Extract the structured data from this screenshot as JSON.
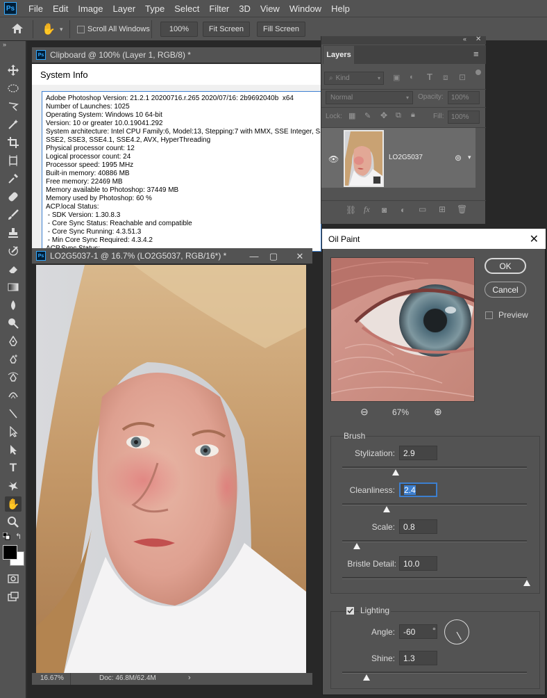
{
  "app": {
    "logo": "Ps"
  },
  "menu": [
    "File",
    "Edit",
    "Image",
    "Layer",
    "Type",
    "Select",
    "Filter",
    "3D",
    "View",
    "Window",
    "Help"
  ],
  "options_bar": {
    "scroll_all_label": "Scroll All Windows",
    "zoom_100": "100%",
    "fit_screen": "Fit Screen",
    "fill_screen": "Fill Screen"
  },
  "clipboard_window": {
    "title": "Clipboard @ 100% (Layer 1, RGB/8) *",
    "sysinfo_title": "System Info",
    "lines": [
      "Adobe Photoshop Version: 21.2.1 20200716.r.265 2020/07/16: 2b9692040b  x64",
      "Number of Launches: 1025",
      "Operating System: Windows 10 64-bit",
      "Version: 10 or greater 10.0.19041.292",
      "System architecture: Intel CPU Family:6, Model:13, Stepping:7 with MMX, SSE Integer, SSE FP,",
      "SSE2, SSE3, SSE4.1, SSE4.2, AVX, HyperThreading",
      "Physical processor count: 12",
      "Logical processor count: 24",
      "Processor speed: 1995 MHz",
      "Built-in memory: 40886 MB",
      "Free memory: 22469 MB",
      "Memory available to Photoshop: 37449 MB",
      "Memory used by Photoshop: 60 %",
      "ACP.local Status:",
      " - SDK Version: 1.30.8.3",
      " - Core Sync Status: Reachable and compatible",
      " - Core Sync Running: 4.3.51.3",
      " - Min Core Sync Required: 4.3.4.2",
      "ACP.Sync Status:"
    ]
  },
  "doc_window": {
    "title": "LO2G5037-1 @ 16.7% (LO2G5037, RGB/16*) *",
    "zoom": "16.67%",
    "doc_info": "Doc: 46.8M/62.4M"
  },
  "layers_panel": {
    "tab": "Layers",
    "kind_label": "Kind",
    "blend_mode": "Normal",
    "opacity_label": "Opacity:",
    "opacity_value": "100%",
    "lock_label": "Lock:",
    "fill_label": "Fill:",
    "fill_value": "100%",
    "layer_name": "LO2G5037"
  },
  "oil_paint": {
    "title": "Oil Paint",
    "ok": "OK",
    "cancel": "Cancel",
    "preview_label": "Preview",
    "preview_checked": false,
    "zoom": "67%",
    "brush_group": "Brush",
    "stylization_label": "Stylization:",
    "stylization": "2.9",
    "stylization_pos": 0.29,
    "cleanliness_label": "Cleanliness:",
    "cleanliness": "2.4",
    "cleanliness_pos": 0.24,
    "scale_label": "Scale:",
    "scale": "0.8",
    "scale_pos": 0.08,
    "bristle_label": "Bristle Detail:",
    "bristle": "10.0",
    "bristle_pos": 1.0,
    "lighting_label": "Lighting",
    "lighting_checked": true,
    "angle_label": "Angle:",
    "angle": "-60",
    "angle_unit": "°",
    "shine_label": "Shine:",
    "shine": "1.3",
    "shine_pos": 0.13
  },
  "colors": {
    "accent": "#3c7fd0",
    "panel": "#535353",
    "workspace": "#282828"
  }
}
